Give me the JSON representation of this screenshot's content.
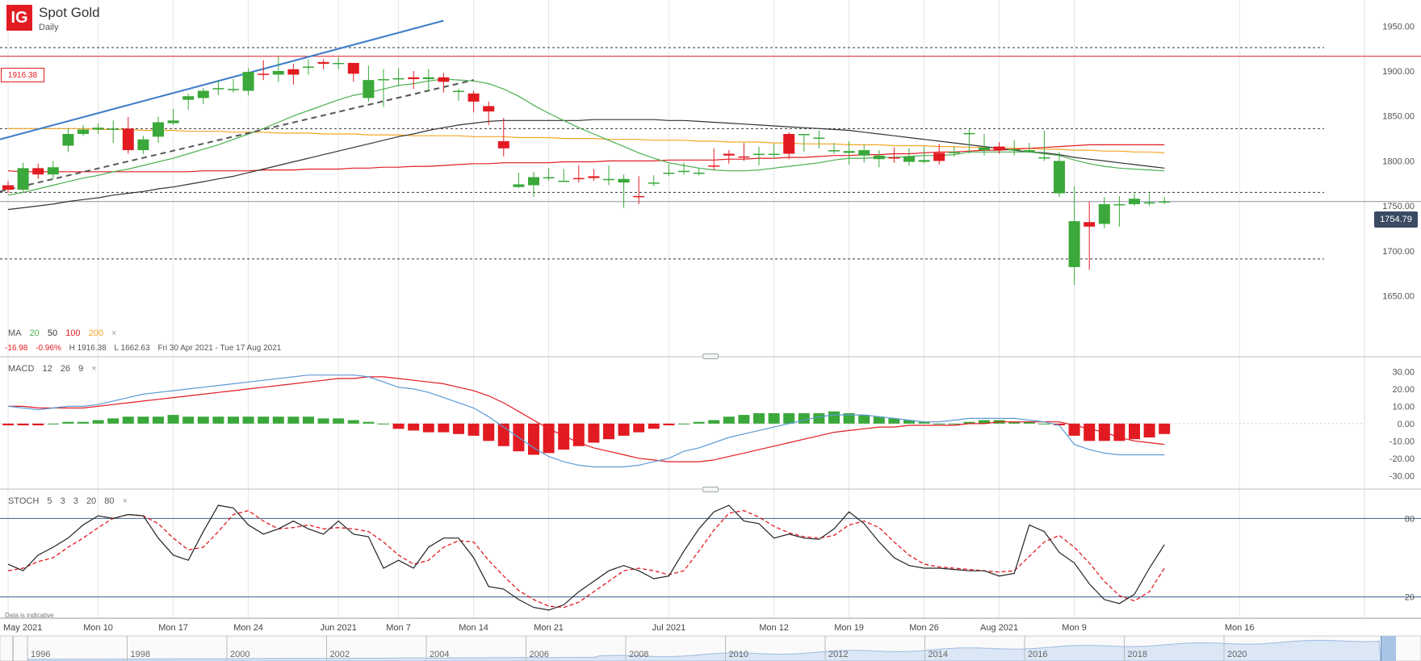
{
  "header": {
    "logo": "IG",
    "title": "Spot Gold",
    "subtitle": "Daily"
  },
  "ma_legend": {
    "label": "MA",
    "periods": [
      {
        "value": "20",
        "color": "#4caf50"
      },
      {
        "value": "50",
        "color": "#333333"
      },
      {
        "value": "100",
        "color": "#e21b22"
      },
      {
        "value": "200",
        "color": "#f5a623"
      }
    ],
    "close": "×"
  },
  "info": {
    "change": "-16.98",
    "change_pct": "-0.96%",
    "high": "H 1916.38",
    "low": "L 1662.63",
    "range": "Fri 30 Apr 2021 - Tue 17 Aug 2021"
  },
  "macd_legend": {
    "label": "MACD",
    "params": [
      "12",
      "26",
      "9"
    ],
    "close": "×"
  },
  "stoch_legend": {
    "label": "STOCH",
    "params": [
      "5",
      "3",
      "3",
      "20",
      "80"
    ],
    "close": "×"
  },
  "disclaimer": "Data is indicative",
  "current_price": "1754.79",
  "level_label": "1916.38",
  "colors": {
    "up": "#3aa83a",
    "down": "#e21b22",
    "ma20": "#4caf50",
    "ma50": "#333333",
    "ma100": "#e21b22",
    "ma200": "#f5a623",
    "trendline": "#3d7cc9",
    "macd_line": "#5b9bd5",
    "signal_line": "#e21b22"
  },
  "navigator": {
    "years": [
      "1996",
      "1998",
      "2000",
      "2002",
      "2004",
      "2006",
      "2008",
      "2010",
      "2012",
      "2014",
      "2016",
      "2018",
      "2020"
    ]
  },
  "chart_data": [
    {
      "type": "candlestick",
      "title": "Spot Gold",
      "subtitle": "Daily",
      "ylim": [
        1620,
        1970
      ],
      "y_ticks": [
        "1950.00",
        "1900.00",
        "1850.00",
        "1800.00",
        "1750.00",
        "1700.00",
        "1650.00"
      ],
      "x_ticks": [
        "May 2021",
        "Mon 10",
        "Mon 17",
        "Mon 24",
        "Jun 2021",
        "Mon 7",
        "Mon 14",
        "Mon 21",
        "Jul 2021",
        "Mon 12",
        "Mon 19",
        "Mon 26",
        "Aug 2021",
        "Mon 9",
        "Mon 16"
      ],
      "dates": [
        "Apr 30",
        "May 3",
        "May 4",
        "May 5",
        "May 6",
        "May 7",
        "May 10",
        "May 11",
        "May 12",
        "May 13",
        "May 14",
        "May 17",
        "May 18",
        "May 19",
        "May 20",
        "May 21",
        "May 24",
        "May 25",
        "May 26",
        "May 27",
        "May 28",
        "May 31",
        "Jun 1",
        "Jun 2",
        "Jun 3",
        "Jun 4",
        "Jun 7",
        "Jun 8",
        "Jun 9",
        "Jun 10",
        "Jun 11",
        "Jun 14",
        "Jun 15",
        "Jun 16",
        "Jun 17",
        "Jun 18",
        "Jun 21",
        "Jun 22",
        "Jun 23",
        "Jun 24",
        "Jun 25",
        "Jun 28",
        "Jun 29",
        "Jun 30",
        "Jul 1",
        "Jul 2",
        "Jul 5",
        "Jul 6",
        "Jul 7",
        "Jul 8",
        "Jul 9",
        "Jul 12",
        "Jul 13",
        "Jul 14",
        "Jul 15",
        "Jul 16",
        "Jul 19",
        "Jul 20",
        "Jul 21",
        "Jul 22",
        "Jul 23",
        "Jul 26",
        "Jul 27",
        "Jul 28",
        "Jul 29",
        "Jul 30",
        "Aug 2",
        "Aug 3",
        "Aug 4",
        "Aug 5",
        "Aug 6",
        "Aug 9",
        "Aug 10",
        "Aug 11",
        "Aug 12",
        "Aug 13",
        "Aug 16",
        "Aug 17"
      ],
      "open": [
        1773,
        1768,
        1792,
        1785,
        1817,
        1830,
        1835,
        1836,
        1836,
        1812,
        1827,
        1842,
        1868,
        1870,
        1880,
        1880,
        1878,
        1897,
        1896,
        1902,
        1905,
        1910,
        1908,
        1909,
        1870,
        1891,
        1891,
        1893,
        1891,
        1893,
        1877,
        1875,
        1861,
        1822,
        1771,
        1773,
        1782,
        1778,
        1781,
        1783,
        1779,
        1776,
        1761,
        1776,
        1787,
        1789,
        1787,
        1795,
        1808,
        1805,
        1808,
        1808,
        1830,
        1829,
        1825,
        1812,
        1809,
        1806,
        1802,
        1804,
        1799,
        1799,
        1809,
        1809,
        1831,
        1812,
        1816,
        1813,
        1810,
        1804,
        1764,
        1682,
        1732,
        1730,
        1752,
        1752,
        1754,
        1755
      ],
      "close": [
        1768,
        1792,
        1785,
        1793,
        1830,
        1835,
        1837,
        1836,
        1812,
        1824,
        1843,
        1845,
        1872,
        1878,
        1881,
        1880,
        1899,
        1896,
        1900,
        1896,
        1905,
        1908,
        1909,
        1897,
        1890,
        1891,
        1892,
        1891,
        1893,
        1888,
        1878,
        1866,
        1855,
        1814,
        1774,
        1782,
        1782,
        1778,
        1780,
        1781,
        1780,
        1780,
        1760,
        1776,
        1787,
        1789,
        1787,
        1794,
        1806,
        1804,
        1808,
        1808,
        1808,
        1830,
        1826,
        1812,
        1811,
        1812,
        1806,
        1803,
        1805,
        1801,
        1800,
        1810,
        1831,
        1815,
        1812,
        1813,
        1812,
        1804,
        1800,
        1733,
        1727,
        1752,
        1752,
        1758,
        1754,
        1755
      ],
      "high": [
        1778,
        1798,
        1797,
        1800,
        1836,
        1840,
        1842,
        1845,
        1849,
        1828,
        1849,
        1858,
        1875,
        1881,
        1890,
        1891,
        1903,
        1912,
        1916,
        1908,
        1913,
        1913,
        1915,
        1907,
        1906,
        1902,
        1903,
        1900,
        1902,
        1898,
        1880,
        1878,
        1866,
        1848,
        1787,
        1788,
        1792,
        1791,
        1795,
        1791,
        1795,
        1785,
        1783,
        1784,
        1797,
        1798,
        1792,
        1814,
        1812,
        1820,
        1816,
        1819,
        1832,
        1829,
        1834,
        1820,
        1822,
        1818,
        1812,
        1815,
        1814,
        1816,
        1819,
        1816,
        1836,
        1830,
        1821,
        1823,
        1820,
        1834,
        1810,
        1772,
        1755,
        1760,
        1761,
        1764,
        1764,
        1760
      ],
      "low": [
        1764,
        1765,
        1780,
        1780,
        1810,
        1828,
        1830,
        1820,
        1808,
        1808,
        1820,
        1840,
        1857,
        1863,
        1873,
        1876,
        1873,
        1890,
        1888,
        1885,
        1896,
        1902,
        1902,
        1888,
        1866,
        1860,
        1883,
        1880,
        1877,
        1876,
        1867,
        1854,
        1840,
        1805,
        1770,
        1760,
        1778,
        1778,
        1776,
        1778,
        1773,
        1748,
        1752,
        1772,
        1783,
        1785,
        1784,
        1790,
        1797,
        1800,
        1795,
        1803,
        1802,
        1810,
        1814,
        1808,
        1796,
        1798,
        1793,
        1798,
        1795,
        1797,
        1796,
        1805,
        1808,
        1806,
        1808,
        1806,
        1810,
        1800,
        1760,
        1662,
        1679,
        1725,
        1727,
        1750,
        1750,
        1752
      ],
      "ma20": [
        1762,
        1765,
        1769,
        1773,
        1777,
        1781,
        1784,
        1788,
        1791,
        1795,
        1799,
        1803,
        1808,
        1813,
        1818,
        1824,
        1830,
        1836,
        1843,
        1850,
        1856,
        1862,
        1868,
        1873,
        1876,
        1880,
        1884,
        1886,
        1889,
        1891,
        1890,
        1889,
        1886,
        1880,
        1872,
        1862,
        1853,
        1845,
        1837,
        1830,
        1823,
        1816,
        1809,
        1803,
        1798,
        1795,
        1792,
        1790,
        1789,
        1789,
        1790,
        1792,
        1794,
        1796,
        1798,
        1801,
        1803,
        1803,
        1804,
        1804,
        1805,
        1806,
        1806,
        1807,
        1810,
        1810,
        1810,
        1810,
        1810,
        1808,
        1806,
        1801,
        1797,
        1794,
        1792,
        1791,
        1790,
        1789
      ],
      "ma50": [
        1746,
        1748,
        1750,
        1752,
        1755,
        1757,
        1759,
        1762,
        1764,
        1766,
        1769,
        1771,
        1774,
        1777,
        1780,
        1783,
        1787,
        1791,
        1795,
        1799,
        1803,
        1807,
        1811,
        1815,
        1819,
        1823,
        1827,
        1830,
        1834,
        1837,
        1840,
        1842,
        1844,
        1845,
        1845,
        1845,
        1845,
        1845,
        1845,
        1846,
        1846,
        1846,
        1846,
        1846,
        1845,
        1845,
        1844,
        1843,
        1842,
        1841,
        1840,
        1839,
        1838,
        1837,
        1836,
        1835,
        1834,
        1832,
        1830,
        1828,
        1826,
        1824,
        1822,
        1820,
        1818,
        1816,
        1814,
        1812,
        1810,
        1809,
        1807,
        1804,
        1802,
        1800,
        1798,
        1796,
        1794,
        1792
      ],
      "ma100": [
        1789,
        1788,
        1788,
        1788,
        1788,
        1788,
        1788,
        1788,
        1788,
        1788,
        1788,
        1788,
        1788,
        1789,
        1789,
        1789,
        1789,
        1790,
        1790,
        1790,
        1791,
        1791,
        1791,
        1792,
        1792,
        1793,
        1793,
        1794,
        1794,
        1795,
        1796,
        1797,
        1797,
        1798,
        1798,
        1798,
        1798,
        1799,
        1799,
        1799,
        1800,
        1800,
        1800,
        1800,
        1801,
        1801,
        1801,
        1801,
        1802,
        1802,
        1803,
        1803,
        1804,
        1804,
        1805,
        1806,
        1806,
        1807,
        1807,
        1808,
        1808,
        1809,
        1810,
        1810,
        1811,
        1812,
        1812,
        1813,
        1814,
        1815,
        1816,
        1817,
        1818,
        1818,
        1818,
        1818,
        1818,
        1818
      ],
      "ma200": [
        1836,
        1836,
        1836,
        1836,
        1836,
        1836,
        1835,
        1835,
        1835,
        1834,
        1834,
        1834,
        1833,
        1833,
        1833,
        1832,
        1832,
        1832,
        1831,
        1831,
        1831,
        1830,
        1830,
        1830,
        1829,
        1829,
        1829,
        1828,
        1828,
        1828,
        1828,
        1827,
        1827,
        1827,
        1826,
        1826,
        1826,
        1825,
        1825,
        1825,
        1824,
        1824,
        1824,
        1823,
        1823,
        1823,
        1822,
        1822,
        1821,
        1821,
        1821,
        1820,
        1820,
        1819,
        1819,
        1819,
        1818,
        1818,
        1818,
        1817,
        1817,
        1817,
        1816,
        1816,
        1815,
        1815,
        1815,
        1814,
        1814,
        1813,
        1813,
        1812,
        1812,
        1811,
        1811,
        1810,
        1810,
        1809
      ],
      "trendlines": [
        {
          "from": [
            "Apr 30",
            1824
          ],
          "to": [
            "Jun 10",
            1956
          ],
          "color": "#3d7cc9",
          "style": "solid"
        },
        {
          "from": [
            "Apr 30",
            1766
          ],
          "to": [
            "Jun 14",
            1890
          ],
          "color": "#555555",
          "style": "dashed"
        }
      ],
      "h_levels": [
        {
          "value": 1926,
          "style": "dotted",
          "color": "#333333"
        },
        {
          "value": 1916.38,
          "style": "solid",
          "color": "#e21b22"
        },
        {
          "value": 1836,
          "style": "dotted",
          "color": "#333333"
        },
        {
          "value": 1765,
          "style": "dotted",
          "color": "#333333"
        },
        {
          "value": 1754.79,
          "style": "solid",
          "color": "#8a93a3"
        },
        {
          "value": 1691,
          "style": "dotted",
          "color": "#333333"
        }
      ]
    },
    {
      "type": "macd",
      "title": "MACD 12 26 9",
      "ylim": [
        -35,
        33
      ],
      "y_ticks": [
        "30.00",
        "20.00",
        "10.00",
        "0.00",
        "-10.00",
        "-20.00",
        "-30.00"
      ],
      "macd": [
        10,
        9,
        8,
        9,
        10,
        10,
        11,
        13,
        15,
        17,
        18,
        19,
        20,
        21,
        22,
        23,
        24,
        25,
        26,
        27,
        28,
        28,
        28,
        28,
        27,
        24,
        21,
        20,
        18,
        15,
        12,
        9,
        4,
        -2,
        -8,
        -14,
        -19,
        -22,
        -24,
        -25,
        -25,
        -25,
        -24,
        -22,
        -20,
        -16,
        -14,
        -11,
        -8,
        -6,
        -4,
        -2,
        0,
        2,
        4,
        5,
        5,
        5,
        4,
        3,
        2,
        1,
        1,
        2,
        3,
        3,
        3,
        3,
        2,
        1,
        -1,
        -12,
        -15,
        -17,
        -18,
        -18,
        -18,
        -18
      ],
      "signal": [
        10,
        10,
        9,
        9,
        9,
        9,
        10,
        11,
        12,
        13,
        14,
        15,
        16,
        17,
        18,
        19,
        20,
        21,
        22,
        23,
        24,
        25,
        26,
        26,
        27,
        27,
        26,
        25,
        24,
        23,
        21,
        19,
        16,
        12,
        7,
        2,
        -3,
        -7,
        -11,
        -14,
        -16,
        -18,
        -20,
        -21,
        -22,
        -22,
        -22,
        -21,
        -19,
        -17,
        -15,
        -13,
        -11,
        -9,
        -7,
        -5,
        -4,
        -3,
        -2,
        -2,
        -1,
        -1,
        -1,
        -1,
        0,
        0,
        1,
        1,
        1,
        1,
        1,
        -1,
        -3,
        -5,
        -8,
        -10,
        -11,
        -12
      ],
      "histogram": [
        -1,
        -1,
        -1,
        0,
        1,
        1,
        2,
        3,
        4,
        4,
        4,
        5,
        4,
        4,
        4,
        4,
        4,
        4,
        4,
        4,
        4,
        3,
        3,
        2,
        1,
        0,
        -3,
        -4,
        -5,
        -5,
        -6,
        -7,
        -10,
        -13,
        -16,
        -18,
        -17,
        -15,
        -13,
        -11,
        -9,
        -7,
        -5,
        -3,
        -1,
        0,
        1,
        2,
        4,
        5,
        6,
        6,
        6,
        6,
        6,
        7,
        6,
        5,
        4,
        3,
        2,
        1,
        0,
        0,
        1,
        2,
        2,
        1,
        1,
        0,
        -1,
        -7,
        -10,
        -10,
        -10,
        -9,
        -8,
        -6
      ]
    },
    {
      "type": "stochastic",
      "title": "STOCH 5 3 3 20 80",
      "ylim": [
        5,
        95
      ],
      "y_ticks": [
        "80",
        "20"
      ],
      "levels": [
        80,
        20
      ],
      "k": [
        45,
        40,
        52,
        58,
        65,
        75,
        82,
        80,
        83,
        82,
        65,
        52,
        48,
        70,
        90,
        88,
        75,
        68,
        72,
        78,
        72,
        68,
        78,
        68,
        66,
        42,
        48,
        42,
        58,
        65,
        65,
        50,
        28,
        26,
        18,
        12,
        10,
        14,
        24,
        32,
        40,
        44,
        40,
        34,
        36,
        55,
        72,
        85,
        90,
        78,
        76,
        65,
        68,
        65,
        64,
        72,
        85,
        76,
        62,
        50,
        44,
        42,
        42,
        41,
        40,
        40,
        36,
        38,
        75,
        70,
        54,
        46,
        30,
        18,
        15,
        22,
        42,
        60
      ],
      "d": [
        40,
        42,
        47,
        50,
        58,
        65,
        73,
        80,
        83,
        82,
        76,
        65,
        56,
        58,
        70,
        83,
        86,
        78,
        72,
        73,
        75,
        72,
        73,
        72,
        70,
        62,
        52,
        45,
        48,
        58,
        63,
        62,
        48,
        36,
        25,
        18,
        13,
        12,
        16,
        24,
        32,
        40,
        42,
        40,
        37,
        40,
        55,
        71,
        84,
        86,
        81,
        74,
        69,
        66,
        65,
        67,
        75,
        78,
        73,
        62,
        52,
        45,
        43,
        42,
        41,
        40,
        39,
        40,
        51,
        62,
        67,
        58,
        46,
        32,
        21,
        17,
        24,
        42
      ]
    }
  ]
}
